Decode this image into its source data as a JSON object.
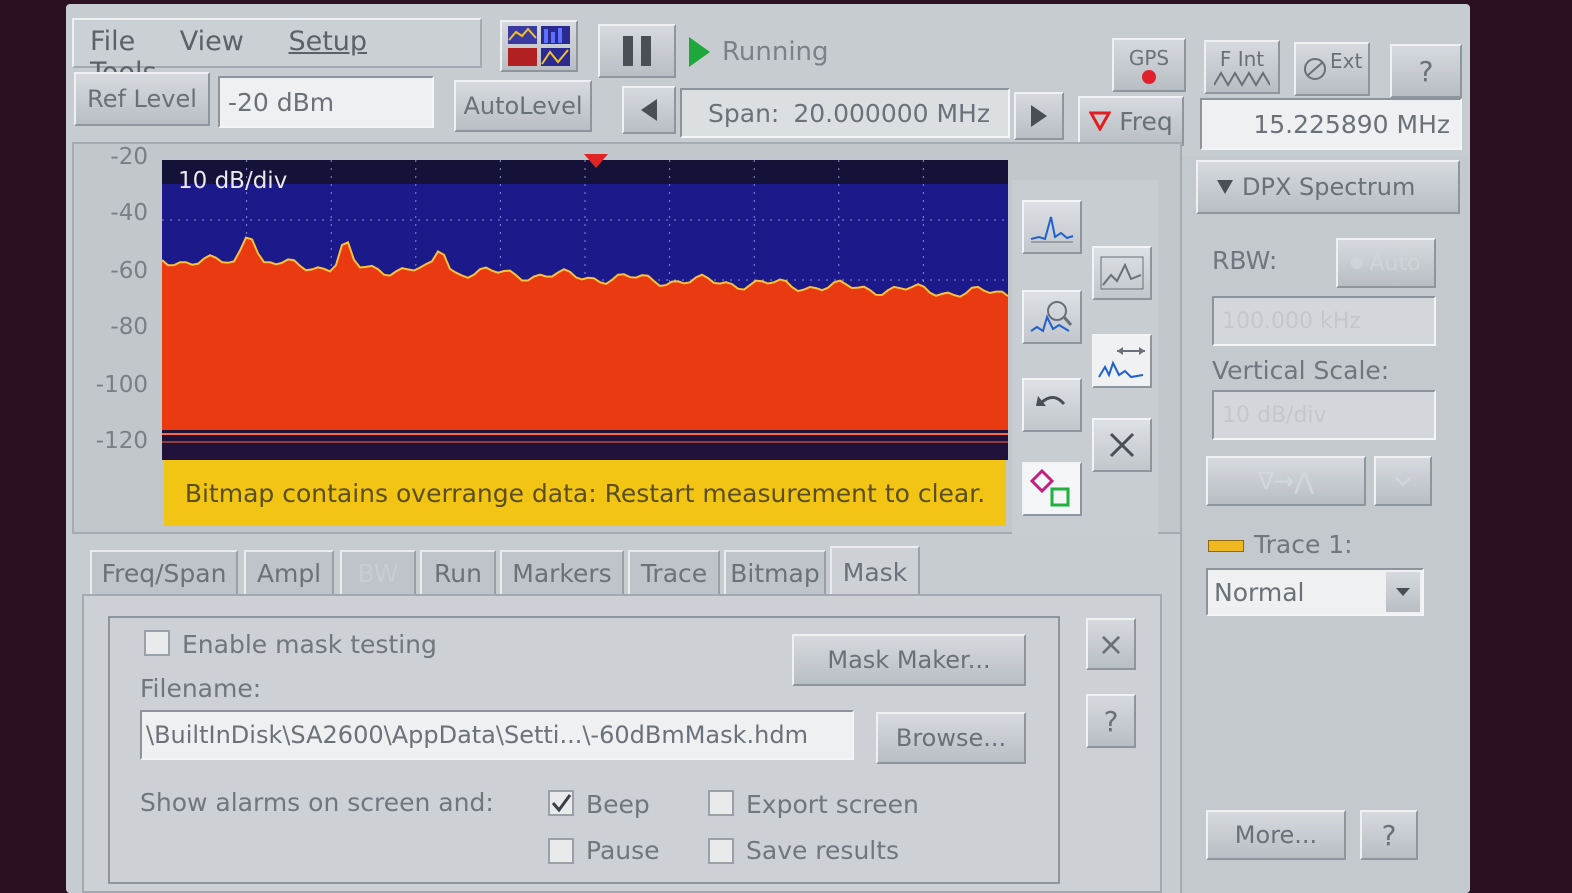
{
  "menu": {
    "file": "File",
    "view": "View",
    "setup": "Setup",
    "tools": "Tools"
  },
  "run_state": {
    "label": "Running"
  },
  "status_buttons": {
    "gps": "GPS",
    "f_int": "F Int",
    "ext": "Ext",
    "help": "?"
  },
  "ref_level": {
    "label": "Ref Level",
    "value": "-20 dBm",
    "autolevel": "AutoLevel"
  },
  "span": {
    "label": "Span:",
    "value": "20.000000 MHz"
  },
  "freq": {
    "label": "Freq",
    "value": "15.225890 MHz"
  },
  "plot": {
    "scale_label": "10 dB/div",
    "y_ticks": [
      "-20",
      "-40",
      "-60",
      "-80",
      "-100",
      "-120"
    ],
    "warning": "Bitmap contains overrange data: Restart measurement to clear.",
    "colors": {
      "background": "#1c1a8a",
      "fill": "#ea3a12",
      "trace": "#f7c33a",
      "warning_bg": "#f2c514"
    }
  },
  "tabs": [
    {
      "label": "Freq/Span"
    },
    {
      "label": "Ampl"
    },
    {
      "label": "BW"
    },
    {
      "label": "Run"
    },
    {
      "label": "Markers"
    },
    {
      "label": "Trace"
    },
    {
      "label": "Bitmap"
    },
    {
      "label": "Mask"
    }
  ],
  "mask_panel": {
    "enable_label": "Enable mask testing",
    "mask_maker": "Mask Maker...",
    "filename_label": "Filename:",
    "filename_value": "\\BuiltInDisk\\SA2600\\AppData\\Setti...\\-60dBmMask.hdm",
    "browse": "Browse...",
    "alarms_label": "Show alarms on screen and:",
    "beep": "Beep",
    "beep_checked": true,
    "export": "Export screen",
    "pause": "Pause",
    "save": "Save results",
    "close": "×",
    "help": "?"
  },
  "side_panel": {
    "title": "DPX Spectrum",
    "rbw_label": "RBW:",
    "rbw_auto": "Auto",
    "rbw_value": "100.000 kHz",
    "vscale_label": "Vertical Scale:",
    "vscale_value": "10 dB/div",
    "arrow_button": "∇→⋀",
    "trace_label": "Trace 1:",
    "trace_mode": "Normal",
    "more": "More...",
    "help": "?"
  }
}
